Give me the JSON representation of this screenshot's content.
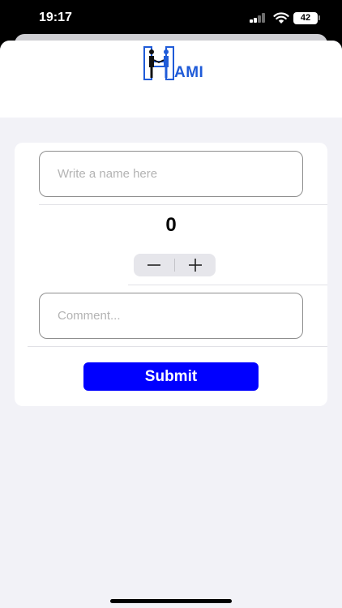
{
  "status_bar": {
    "time": "19:17",
    "battery_level": "42"
  },
  "header": {
    "logo_text": "AMI",
    "logo_color": "#1f5bd8"
  },
  "form": {
    "name_placeholder": "Write a name here",
    "name_value": "",
    "counter_value": "0",
    "stepper": {
      "minus_icon": "minus-icon",
      "plus_icon": "plus-icon"
    },
    "comment_placeholder": "Comment...",
    "comment_value": "",
    "submit_label": "Submit",
    "submit_color": "#0000ff"
  }
}
